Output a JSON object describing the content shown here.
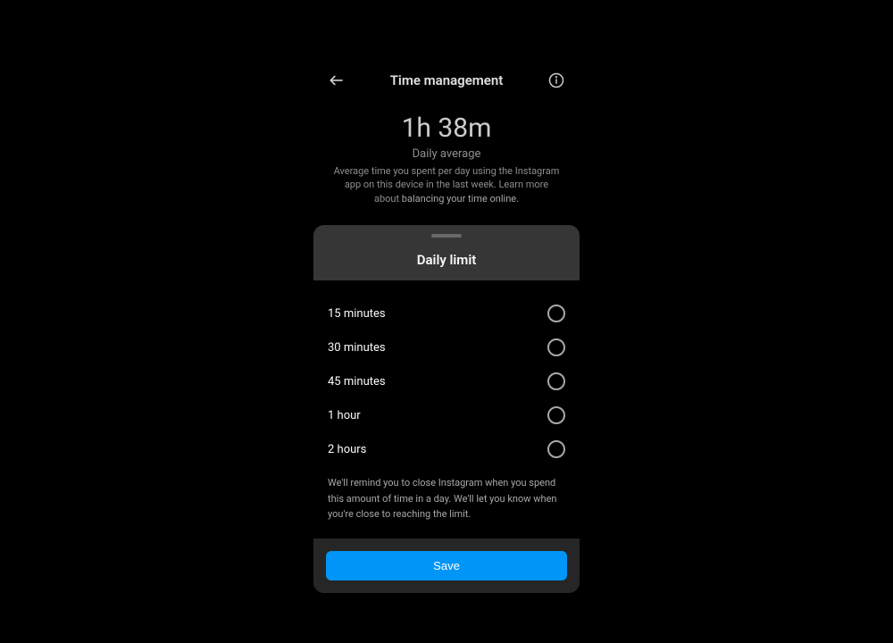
{
  "header": {
    "title": "Time management"
  },
  "stats": {
    "time_value": "1h 38m",
    "time_label": "Daily average",
    "description_pre": "Average time you spent per day using the Instagram app on this device in the last week. Learn more about ",
    "description_link": "balancing your time online.",
    "description_post": ""
  },
  "sheet": {
    "title": "Daily limit",
    "options": [
      {
        "label": "15 minutes"
      },
      {
        "label": "30 minutes"
      },
      {
        "label": "45 minutes"
      },
      {
        "label": "1 hour"
      },
      {
        "label": "2 hours"
      }
    ],
    "note": "We'll remind you to close Instagram when you spend this amount of time in a day. We'll let you know when you're close to reaching the limit.",
    "save_label": "Save"
  }
}
